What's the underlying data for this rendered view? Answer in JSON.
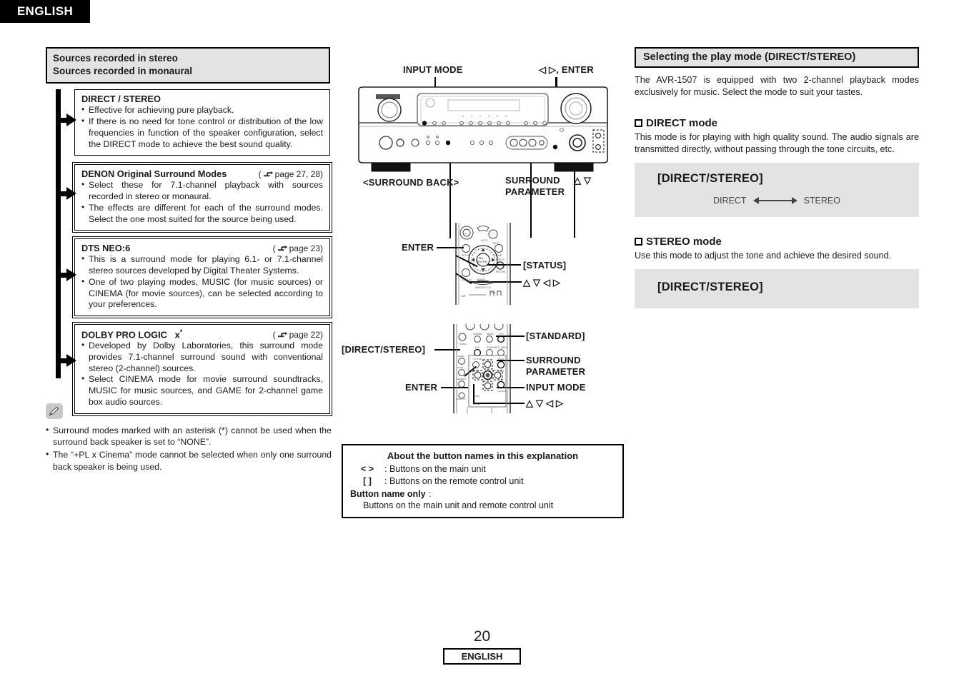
{
  "header": {
    "language_tab": "ENGLISH"
  },
  "left": {
    "source_header": {
      "line1": "Sources recorded in stereo",
      "line2": "Sources recorded in monaural"
    },
    "modes": [
      {
        "title": "DIRECT / STEREO",
        "page_ref": "",
        "bullets": [
          "Effective for achieving pure playback.",
          "If there is no need for tone control or distribution of the low frequencies in function of the speaker configuration, select the DIRECT mode to achieve the best sound quality."
        ]
      },
      {
        "title": "DENON Original Surround Modes",
        "page_ref": "page 27, 28)",
        "bullets": [
          "Select these for 7.1-channel playback with sources recorded in stereo or monaural.",
          "The effects are different for each of the surround modes. Select the one most suited for the source being used."
        ]
      },
      {
        "title": "DTS NEO:6",
        "page_ref": "page 23)",
        "bullets": [
          "This is a surround mode for playing 6.1- or 7.1-channel stereo sources developed by Digital Theater Systems.",
          "One of two playing modes, MUSIC (for music sources) or CINEMA (for movie sources), can be selected according to your preferences."
        ]
      },
      {
        "title": "DOLBY PRO LOGIC",
        "title_suffix": "x",
        "title_asterisk": "*",
        "page_ref": "page 22)",
        "bullets": [
          "Developed by Dolby Laboratories, this surround mode provides 7.1-channel surround sound with conventional stereo (2-channel) sources.",
          "Select CINEMA mode for movie surround soundtracks, MUSIC for music sources, and GAME for 2-channel game box audio sources."
        ]
      }
    ],
    "notes": [
      "Surround modes marked with an asterisk (*) cannot be used when the surround back speaker is set to “NONE”.",
      "The “+PL x Cinema” mode cannot be selected when only one surround back speaker is being used."
    ]
  },
  "middle": {
    "receiver_labels": {
      "input_mode": "INPUT MODE",
      "enter_lr": "◁ ▷, ENTER",
      "surround_back": "<SURROUND BACK>",
      "surround_parameter_l1": "SURROUND",
      "surround_parameter_l2": "PARAMETER",
      "updown": "△ ▽"
    },
    "remote1_labels": {
      "enter": "ENTER",
      "status": "[STATUS]",
      "cursor": "△ ▽ ◁ ▷"
    },
    "remote2_labels": {
      "direct_stereo": "[DIRECT/STEREO]",
      "standard": "[STANDARD]",
      "surround_parameter_l1": "SURROUND",
      "surround_parameter_l2": "PARAMETER",
      "input_mode": "INPUT MODE",
      "enter": "ENTER",
      "cursor": "△ ▽ ◁ ▷"
    },
    "about_box": {
      "title": "About the button names in this explanation",
      "rows": [
        {
          "symbol": "<    >",
          "desc": ": Buttons on the main unit"
        },
        {
          "symbol": "[    ]",
          "desc": ": Buttons on the remote control unit"
        }
      ],
      "bold_label": "Button name only",
      "bold_colon": ":",
      "bold_desc": "Buttons on the main unit and remote control unit"
    }
  },
  "right": {
    "section_title": "Selecting the play mode (DIRECT/STEREO)",
    "intro": "The AVR-1507 is equipped with two 2-channel playback modes exclusively for music. Select the mode to suit your tastes.",
    "direct": {
      "heading": "DIRECT mode",
      "body": "This mode is for playing with high quality sound. The audio signals are transmitted directly, without passing through the tone circuits, etc.",
      "panel_title": "[DIRECT/STEREO]",
      "flow_left": "DIRECT",
      "flow_right": "STEREO"
    },
    "stereo": {
      "heading": "STEREO mode",
      "body": "Use this mode to adjust the tone and achieve the desired sound.",
      "panel_title": "[DIRECT/STEREO]"
    }
  },
  "footer": {
    "page_number": "20",
    "language": "ENGLISH"
  }
}
